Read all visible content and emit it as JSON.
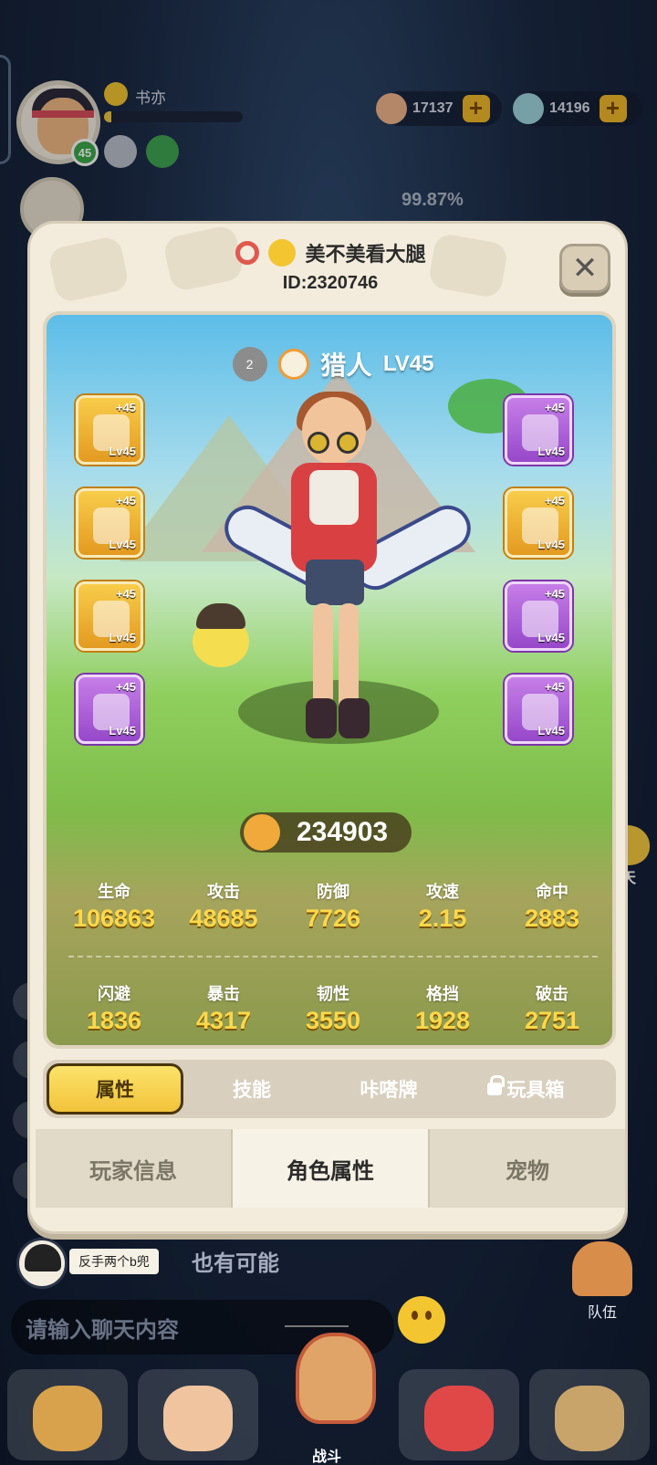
{
  "lobby": {
    "player": {
      "name": "书亦",
      "level": "45",
      "exp_fraction": 0.05
    },
    "resources": [
      {
        "icon": "shell-icon",
        "value": "17137"
      },
      {
        "icon": "gem-icon",
        "value": "14196"
      }
    ],
    "trophy_percent": "99.87%",
    "chat_float_label": "聊天",
    "chat": {
      "sender": "反手两个b兜",
      "message": "也有可能",
      "input_placeholder": "请输入聊天内容"
    },
    "team_label": "队伍",
    "battle_label": "战斗"
  },
  "modal": {
    "title": "美不美看大腿",
    "id_text": "ID:2320746",
    "close_symbol": "✕",
    "character": {
      "rank": "2",
      "class_name": "猎人",
      "level": "LV45"
    },
    "equipment_left": [
      {
        "plus": "+45",
        "lv": "Lv45",
        "rarity": "gold",
        "icon": "bow-icon"
      },
      {
        "plus": "+45",
        "lv": "Lv45",
        "rarity": "gold",
        "icon": "wolf-helmet-icon"
      },
      {
        "plus": "+45",
        "lv": "Lv45",
        "rarity": "gold",
        "icon": "claw-glove-icon"
      },
      {
        "plus": "+45",
        "lv": "Lv45",
        "rarity": "purple",
        "icon": "ring-icon"
      }
    ],
    "equipment_right": [
      {
        "plus": "+45",
        "lv": "Lv45",
        "rarity": "purple",
        "icon": "arrow-quiver-icon"
      },
      {
        "plus": "+45",
        "lv": "Lv45",
        "rarity": "gold",
        "icon": "armor-icon"
      },
      {
        "plus": "+45",
        "lv": "Lv45",
        "rarity": "purple",
        "icon": "gauntlet-icon"
      },
      {
        "plus": "+45",
        "lv": "Lv45",
        "rarity": "purple",
        "icon": "necklace-icon"
      }
    ],
    "combat_power": "234903",
    "stats_row1": [
      {
        "label": "生命",
        "value": "106863"
      },
      {
        "label": "攻击",
        "value": "48685"
      },
      {
        "label": "防御",
        "value": "7726"
      },
      {
        "label": "攻速",
        "value": "2.15"
      },
      {
        "label": "命中",
        "value": "2883"
      }
    ],
    "stats_row2": [
      {
        "label": "闪避",
        "value": "1836"
      },
      {
        "label": "暴击",
        "value": "4317"
      },
      {
        "label": "韧性",
        "value": "3550"
      },
      {
        "label": "格挡",
        "value": "1928"
      },
      {
        "label": "破击",
        "value": "2751"
      }
    ],
    "upper_tabs": [
      {
        "label": "属性",
        "active": true
      },
      {
        "label": "技能"
      },
      {
        "label": "咔嗒牌"
      },
      {
        "label": "玩具箱",
        "locked": true
      }
    ],
    "lower_tabs": [
      {
        "label": "玩家信息"
      },
      {
        "label": "角色属性",
        "active": true
      },
      {
        "label": "宠物"
      }
    ]
  }
}
